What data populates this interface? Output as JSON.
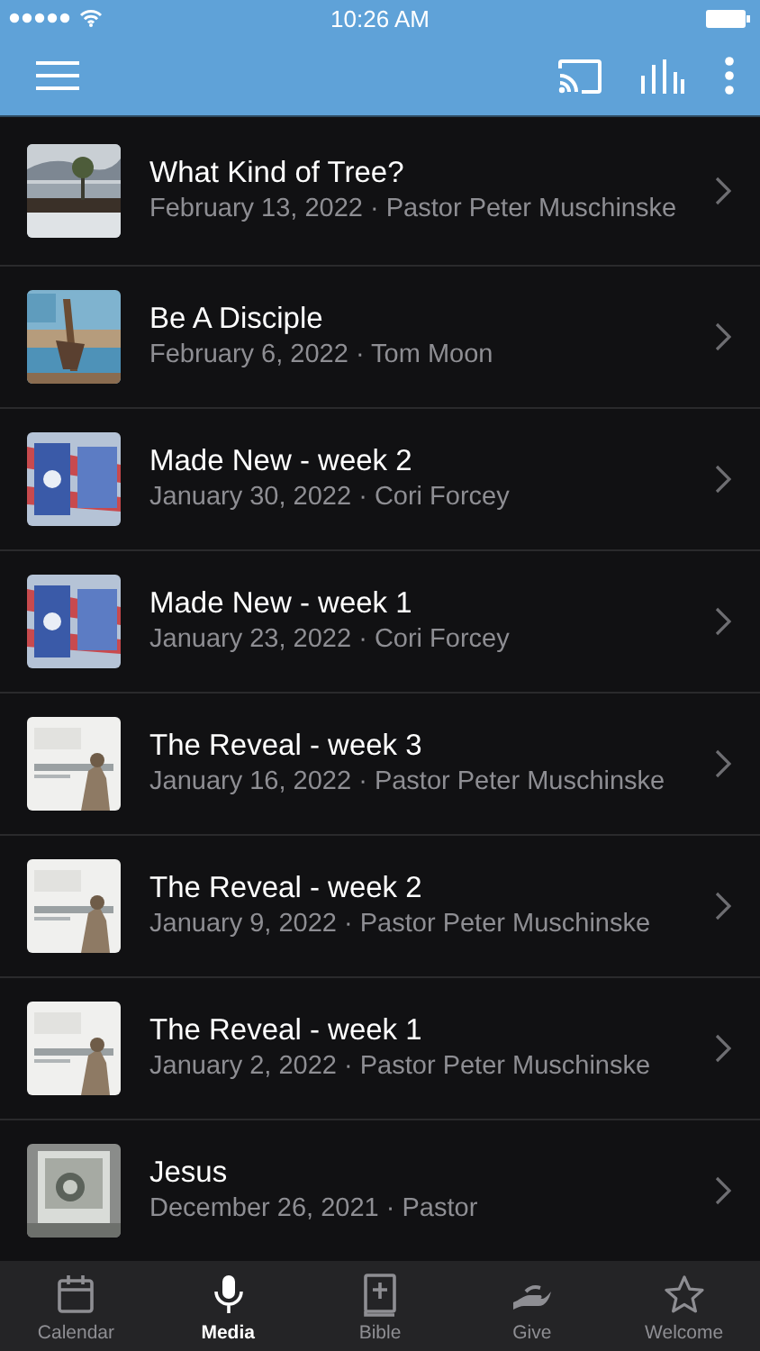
{
  "status_bar": {
    "time": "10:26 AM"
  },
  "sermons": [
    {
      "title": "What Kind of Tree?",
      "subtitle": "February 13, 2022 · Pastor Peter Muschinske"
    },
    {
      "title": "Be A Disciple",
      "subtitle": "February 6, 2022 · Tom Moon"
    },
    {
      "title": "Made New - week 2",
      "subtitle": "January 30, 2022 · Cori Forcey"
    },
    {
      "title": "Made New - week 1",
      "subtitle": "January 23, 2022 · Cori Forcey"
    },
    {
      "title": "The Reveal - week 3",
      "subtitle": "January 16, 2022 · Pastor Peter Muschinske"
    },
    {
      "title": "The Reveal - week 2",
      "subtitle": "January 9, 2022 · Pastor Peter Muschinske"
    },
    {
      "title": "The Reveal - week 1",
      "subtitle": "January 2, 2022 · Pastor Peter Muschinske"
    },
    {
      "title": "Jesus",
      "subtitle": "December 26, 2021 · Pastor"
    }
  ],
  "tabs": [
    {
      "label": "Calendar",
      "kind": "calendar",
      "selected": false
    },
    {
      "label": "Media",
      "kind": "mic",
      "selected": true
    },
    {
      "label": "Bible",
      "kind": "bible",
      "selected": false
    },
    {
      "label": "Give",
      "kind": "give",
      "selected": false
    },
    {
      "label": "Welcome",
      "kind": "star",
      "selected": false
    }
  ]
}
